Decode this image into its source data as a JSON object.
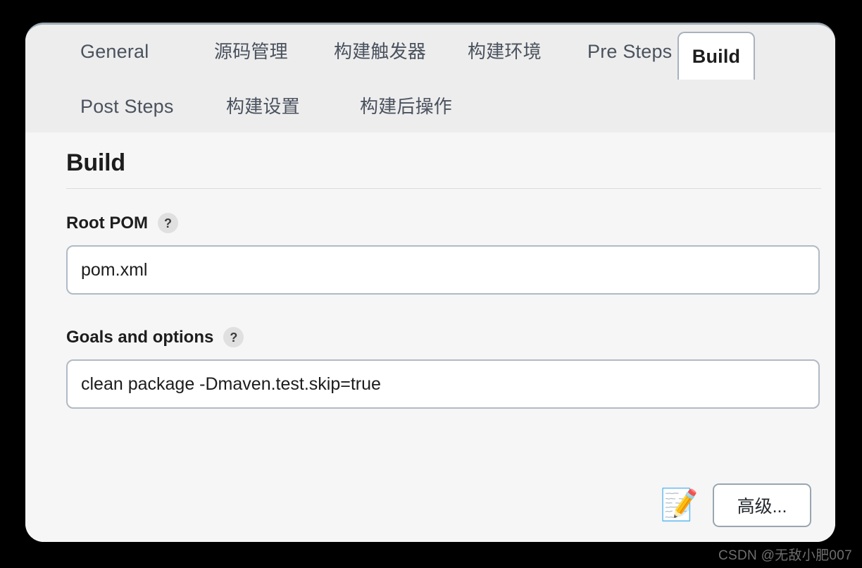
{
  "panel": {
    "tabs_row1": [
      {
        "label": "General",
        "active": false,
        "lang": "en"
      },
      {
        "label": "源码管理",
        "active": false,
        "lang": "cn"
      },
      {
        "label": "构建触发器",
        "active": false,
        "lang": "cn"
      },
      {
        "label": "构建环境",
        "active": false,
        "lang": "cn"
      },
      {
        "label": "Pre Steps",
        "active": false,
        "lang": "en"
      },
      {
        "label": "Build",
        "active": true,
        "lang": "en"
      }
    ],
    "tabs_row2": [
      {
        "label": "Post Steps",
        "active": false,
        "lang": "en"
      },
      {
        "label": "构建设置",
        "active": false,
        "lang": "cn"
      },
      {
        "label": "构建后操作",
        "active": false,
        "lang": "cn"
      }
    ]
  },
  "main": {
    "heading": "Build",
    "fields": [
      {
        "label": "Root POM",
        "help": "?",
        "value": "pom.xml",
        "placeholder": "pom.xml"
      },
      {
        "label": "Goals and options",
        "help": "?",
        "value": "clean package -Dmaven.test.skip=true",
        "placeholder": ""
      }
    ],
    "footer": {
      "memo_icon": "📝",
      "advanced_label": "高级..."
    }
  },
  "watermark": {
    "text": "CSDN @无敌小肥007"
  },
  "colors": {
    "tabbar_bg": "#ededed",
    "body_bg": "#f6f6f6",
    "active_tab_bg": "#ffffff",
    "border": "#b0bac4",
    "text": "#1d1d1d",
    "tab_text": "#4a525e"
  }
}
